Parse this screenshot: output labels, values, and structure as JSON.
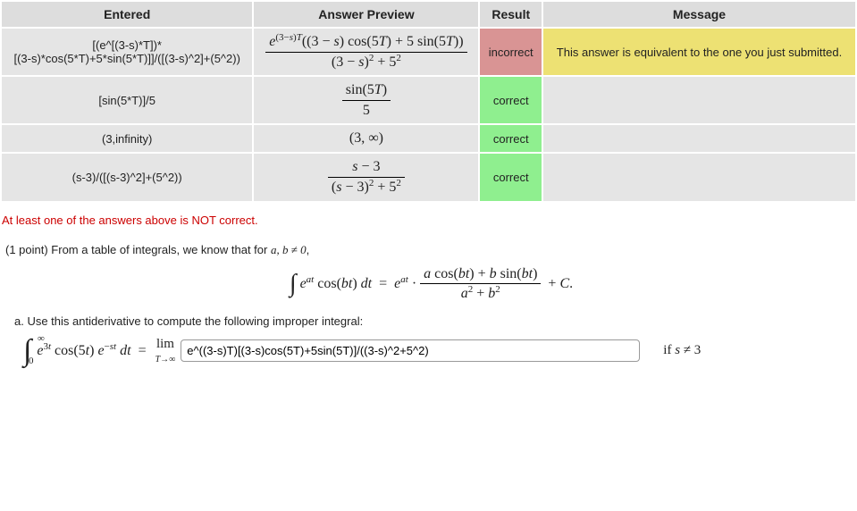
{
  "headers": {
    "entered": "Entered",
    "preview": "Answer Preview",
    "result": "Result",
    "message": "Message"
  },
  "rows": [
    {
      "entered": "[(e^[(3-s)*T])*\n[(3-s)*cos(5*T)+5*sin(5*T)]]/([(3-s)^2]+(5^2))",
      "result": "incorrect",
      "message": "This answer is equivalent to the one you just submitted."
    },
    {
      "entered": "[sin(5*T)]/5",
      "result": "correct",
      "message": ""
    },
    {
      "entered": "(3,infinity)",
      "result": "correct",
      "message": ""
    },
    {
      "entered": "(s-3)/([(s-3)^2]+(5^2))",
      "result": "correct",
      "message": ""
    }
  ],
  "warning": "At least one of the answers above is NOT correct.",
  "problem": {
    "points_prefix": "(1 point) From a table of integrals, we know that for ",
    "points_cond": "a, b ≠ 0",
    "partA": "a. Use this antiderivative to compute the following improper integral:",
    "answer_value": "e^((3-s)T)[(3-s)cos(5T)+5sin(5T)]/((3-s)^2+5^2)",
    "cond_text": "if s ≠ 3"
  },
  "chart_data": {
    "type": "table",
    "columns": [
      "Entered",
      "Answer Preview",
      "Result",
      "Message"
    ],
    "rows": [
      {
        "Entered": "[(e^[(3-s)*T])*[(3-s)*cos(5*T)+5*sin(5*T)]]/([(3-s)^2]+(5^2))",
        "Answer Preview": "e^{(3-s)T}((3-s)cos(5T)+5sin(5T)) / ((3-s)^2 + 5^2)",
        "Result": "incorrect",
        "Message": "This answer is equivalent to the one you just submitted."
      },
      {
        "Entered": "[sin(5*T)]/5",
        "Answer Preview": "sin(5T)/5",
        "Result": "correct",
        "Message": ""
      },
      {
        "Entered": "(3,infinity)",
        "Answer Preview": "(3, ∞)",
        "Result": "correct",
        "Message": ""
      },
      {
        "Entered": "(s-3)/([(s-3)^2]+(5^2))",
        "Answer Preview": "(s-3)/((s-3)^2 + 5^2)",
        "Result": "correct",
        "Message": ""
      }
    ]
  }
}
